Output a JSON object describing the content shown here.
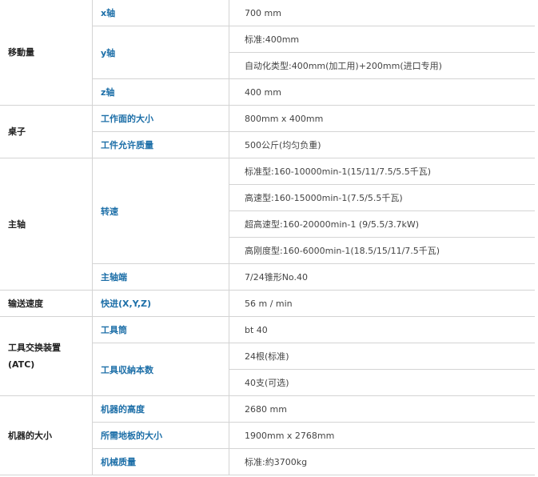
{
  "spec_table": {
    "travel": {
      "category": "移動量",
      "x_label": "x轴",
      "x_value": "700 mm",
      "y_label": "y轴",
      "y_value_1": "标准:400mm",
      "y_value_2": "自动化类型:400mm(加工用)+200mm(进口专用)",
      "z_label": "z轴",
      "z_value": "400 mm"
    },
    "table": {
      "category": "桌子",
      "surface_label": "工作面的大小",
      "surface_value": "800mm x 400mm",
      "load_label": "工件允许质量",
      "load_value": "500公斤(均匀负重)"
    },
    "spindle": {
      "category": "主轴",
      "speed_label": "转速",
      "speed_1": "标准型:160-10000min-1(15/11/7.5/5.5千瓦)",
      "speed_2": "高速型:160-15000min-1(7.5/5.5千瓦)",
      "speed_3": "超高速型:160-20000min-1 (9/5.5/3.7kW)",
      "speed_4": "高刚度型:160-6000min-1(18.5/15/11/7.5千瓦)",
      "nose_label": "主轴端",
      "nose_value": "7/24锥形No.40"
    },
    "feed": {
      "category": "输送速度",
      "rapid_label": "快进(X,Y,Z)",
      "rapid_value": "56 m / min"
    },
    "atc": {
      "category_line1": "工具交换装置",
      "category_line2": "(ATC)",
      "shank_label": "工具筒",
      "shank_value": "bt 40",
      "capacity_label": "工具収納本数",
      "capacity_1": "24根(标准)",
      "capacity_2": "40支(可选)"
    },
    "machine": {
      "category": "机器的大小",
      "height_label": "机器的高度",
      "height_value": "2680 mm",
      "floor_label": "所需地板的大小",
      "floor_value": "1900mm x 2768mm",
      "mass_label": "机械质量",
      "mass_value": "标准:約3700kg"
    }
  }
}
